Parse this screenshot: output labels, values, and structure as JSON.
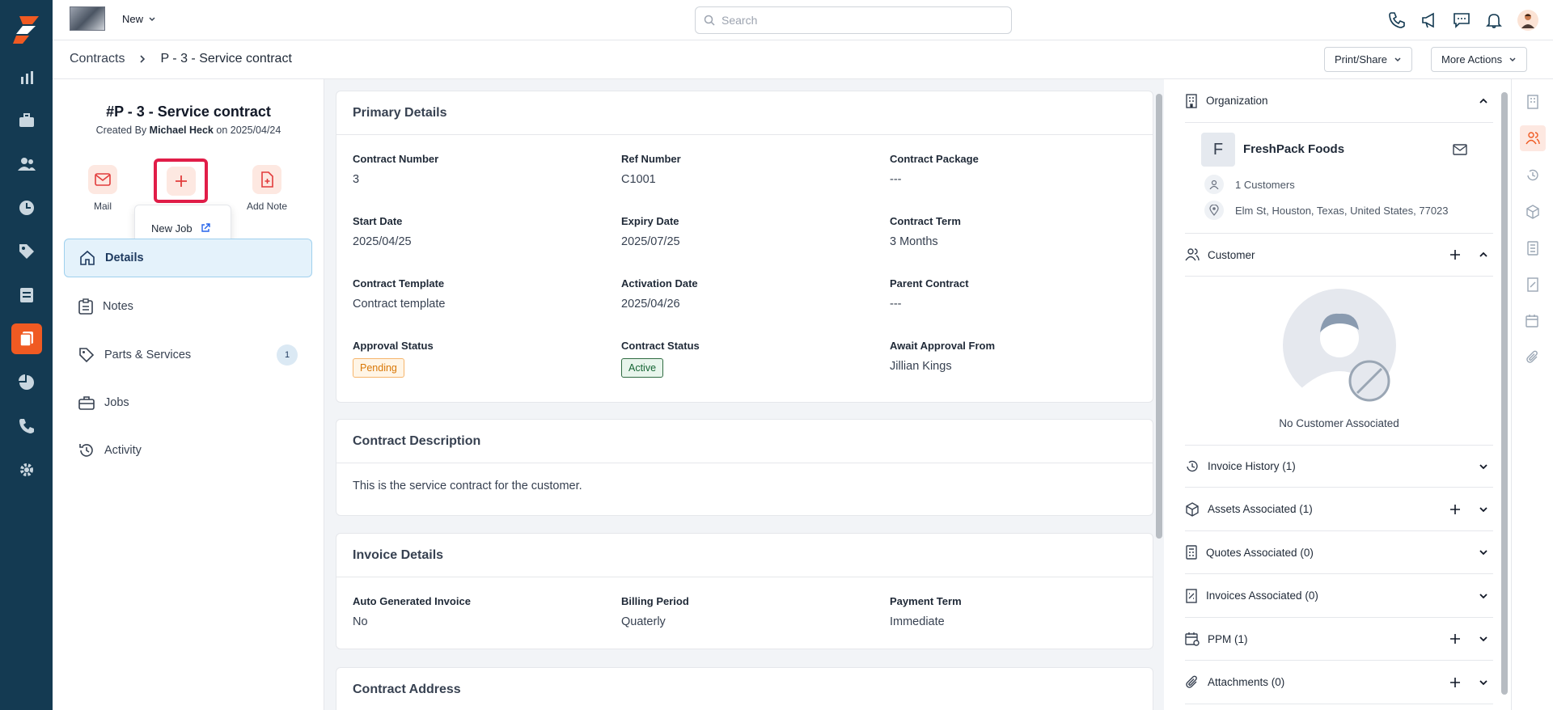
{
  "topbar": {
    "new_label": "New",
    "search_placeholder": "Search"
  },
  "breadcrumb": {
    "root": "Contracts",
    "current": "P - 3 - Service contract"
  },
  "header_actions": {
    "print_share": "Print/Share",
    "more_actions": "More Actions"
  },
  "contract": {
    "title": "#P - 3 - Service contract",
    "created_prefix": "Created By",
    "created_by": "Michael Heck",
    "created_on_prefix": "on",
    "created_on": "2025/04/24"
  },
  "quick_actions": {
    "mail": "Mail",
    "add_note": "Add Note",
    "new_job": "New Job"
  },
  "nav": {
    "details": "Details",
    "notes": "Notes",
    "parts_services": "Parts & Services",
    "parts_services_count": "1",
    "jobs": "Jobs",
    "activity": "Activity"
  },
  "primary_details": {
    "title": "Primary Details",
    "fields": {
      "contract_number_label": "Contract Number",
      "contract_number": "3",
      "ref_number_label": "Ref Number",
      "ref_number": "C1001",
      "contract_package_label": "Contract Package",
      "contract_package": "---",
      "start_date_label": "Start Date",
      "start_date": "2025/04/25",
      "expiry_date_label": "Expiry Date",
      "expiry_date": "2025/07/25",
      "contract_term_label": "Contract Term",
      "contract_term": "3 Months",
      "contract_template_label": "Contract Template",
      "contract_template": "Contract template",
      "activation_date_label": "Activation Date",
      "activation_date": "2025/04/26",
      "parent_contract_label": "Parent Contract",
      "parent_contract": "---",
      "approval_status_label": "Approval Status",
      "approval_status": "Pending",
      "contract_status_label": "Contract Status",
      "contract_status": "Active",
      "await_approval_label": "Await Approval From",
      "await_approval": "Jillian Kings"
    }
  },
  "description": {
    "title": "Contract Description",
    "text": "This is the service contract for the customer."
  },
  "invoice_details": {
    "title": "Invoice Details",
    "auto_label": "Auto Generated Invoice",
    "auto": "No",
    "billing_label": "Billing Period",
    "billing": "Quaterly",
    "payment_label": "Payment Term",
    "payment": "Immediate"
  },
  "address": {
    "title": "Contract Address"
  },
  "right": {
    "organization": "Organization",
    "org_letter": "F",
    "org_name": "FreshPack Foods",
    "customers_count": "1 Customers",
    "org_address": "Elm St, Houston, Texas, United States, 77023",
    "customer": "Customer",
    "no_customer": "No Customer Associated",
    "invoice_history": "Invoice History (1)",
    "assets": "Assets Associated (1)",
    "quotes": "Quotes Associated (0)",
    "invoices": "Invoices Associated (0)",
    "ppm": "PPM (1)",
    "attachments": "Attachments (0)"
  },
  "colors": {
    "rail": "#143a52",
    "accent": "#f05a22",
    "highlight": "#e11d48"
  }
}
